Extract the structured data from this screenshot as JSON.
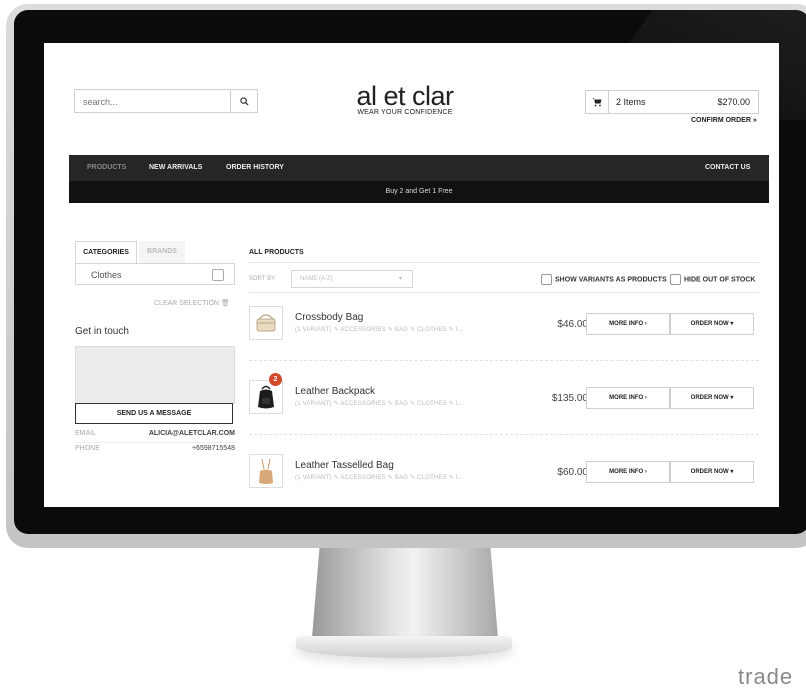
{
  "header": {
    "search_placeholder": "search...",
    "logo_main": "al et clar",
    "logo_tagline": "WEAR YOUR CONFIDENCE",
    "cart_items": "2 Items",
    "cart_total": "$270.00",
    "confirm_order": "CONFIRM ORDER »"
  },
  "nav": {
    "items": [
      "PRODUCTS",
      "NEW ARRIVALS",
      "ORDER HISTORY"
    ],
    "contact": "CONTACT US",
    "active": "PRODUCTS"
  },
  "promo": "Buy 2 and Get 1 Free",
  "sidebar": {
    "tab_categories": "CATEGORIES",
    "tab_brands": "BRANDS",
    "category_item": "Clothes",
    "clear_selection": "CLEAR SELECTION",
    "get_in_touch": "Get in touch",
    "send_message": "SEND US A MESSAGE",
    "email_label": "EMAIL",
    "email_value": "ALICIA@ALETCLAR.COM",
    "phone_label": "PHONE",
    "phone_value": "+6598715548"
  },
  "main": {
    "title": "ALL PRODUCTS",
    "sort_label": "SORT BY",
    "sort_value": "NAME (A-Z)",
    "show_variants": "SHOW VARIANTS AS PRODUCTS",
    "hide_out_of_stock": "HIDE OUT OF STOCK",
    "more_info": "MORE INFO ›",
    "order_now": "ORDER NOW ▾",
    "products": [
      {
        "name": "Crossbody Bag",
        "tags": "(1 VARIANT)  ✎ ACCESSORIES  ✎ BAG  ✎ CLOTHES  ✎ I...",
        "price": "$46.00",
        "badge": ""
      },
      {
        "name": "Leather Backpack",
        "tags": "(1 VARIANT)  ✎ ACCESSORIES  ✎ BAG  ✎ CLOTHES  ✎ I...",
        "price": "$135.00",
        "badge": "2"
      },
      {
        "name": "Leather Tasselled Bag",
        "tags": "(1 VARIANT)  ✎ ACCESSORIES  ✎ BAG  ✎ CLOTHES  ✎ I...",
        "price": "$60.00",
        "badge": ""
      }
    ]
  },
  "corner_brand": "trade",
  "colors": {
    "nav_bg": "#262626",
    "promo_bg": "#111111",
    "badge": "#d24a2a"
  }
}
